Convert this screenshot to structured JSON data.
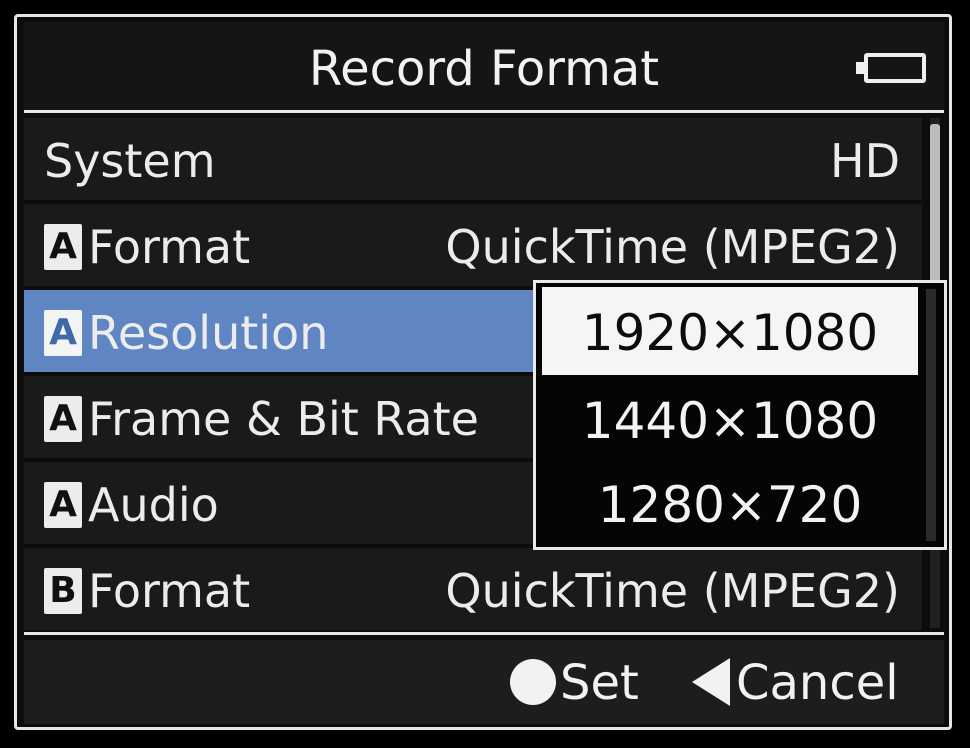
{
  "header": {
    "title": "Record Format",
    "battery_icon": "battery-icon"
  },
  "menu": {
    "rows": [
      {
        "slot": "",
        "label": "System",
        "value": "HD"
      },
      {
        "slot": "A",
        "label": "Format",
        "value": "QuickTime (MPEG2)"
      },
      {
        "slot": "A",
        "label": "Resolution",
        "value": ""
      },
      {
        "slot": "A",
        "label": "Frame & Bit Rate",
        "value": ""
      },
      {
        "slot": "A",
        "label": "Audio",
        "value": ""
      },
      {
        "slot": "B",
        "label": "Format",
        "value": "QuickTime (MPEG2)"
      }
    ],
    "selected_index": 2
  },
  "popup": {
    "options": [
      "1920×1080",
      "1440×1080",
      "1280×720"
    ],
    "selected_index": 0
  },
  "footer": {
    "set_label": "Set",
    "cancel_label": "Cancel",
    "set_icon": "circle-icon",
    "cancel_icon": "left-triangle-icon"
  },
  "colors": {
    "selection": "#5f86c2",
    "background": "#000000",
    "text": "#ececec"
  }
}
